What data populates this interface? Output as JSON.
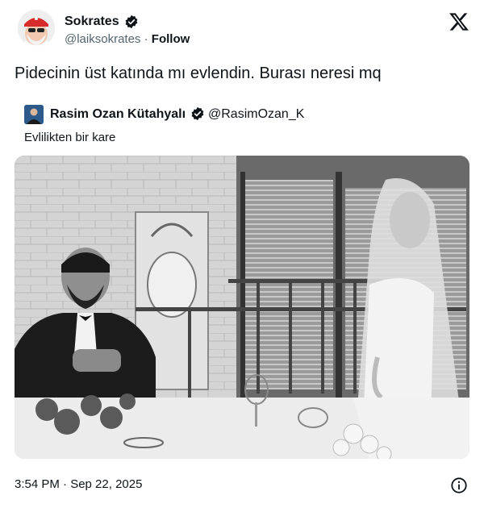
{
  "author": {
    "name": "Sokrates",
    "handle": "@laiksokrates",
    "separator": "·",
    "follow_label": "Follow"
  },
  "tweet": {
    "text": "Pidecinin üst katında mı evlendin. Burası neresi mq"
  },
  "quoted": {
    "name": "Rasim Ozan Kütahyalı",
    "handle": "@RasimOzan_K",
    "text": "Evlilikten bir kare"
  },
  "footer": {
    "timestamp": "3:54 PM · Sep 22, 2025"
  },
  "icons": {
    "verified": "verified-badge-icon",
    "x_logo": "x-logo-icon",
    "info": "info-icon"
  },
  "colors": {
    "text": "#0f1419",
    "secondary": "#536471",
    "verified_badge": "#0f1419"
  }
}
